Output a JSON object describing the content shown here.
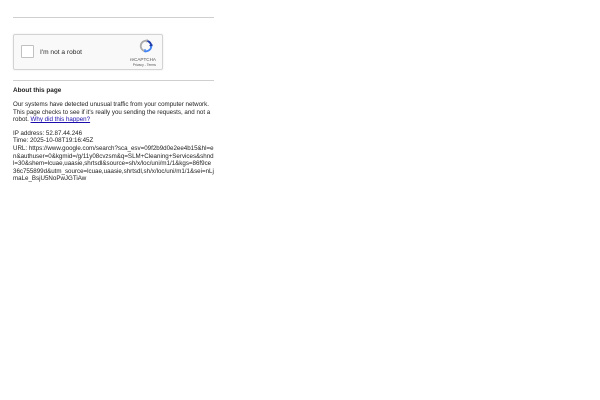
{
  "captcha": {
    "label": "I'm not a robot",
    "brand": "reCAPTCHA",
    "privacy": "Privacy",
    "separator": " - ",
    "terms": "Terms"
  },
  "about": {
    "title": "About this page",
    "body": "Our systems have detected unusual traffic from your computer network. This page checks to see if it's really you sending the requests, and not a robot. ",
    "link": "Why did this happen?"
  },
  "info": {
    "ip_label": "IP address: ",
    "ip": "52.87.44.246",
    "time_label": "Time: ",
    "time": "2025-10-08T19:16:45Z",
    "url_label": "URL: ",
    "url": "https://www.google.com/search?sca_esv=09f2b9d0e2ee4b15&hl=en&authuser=0&kgmid=/g/11y08cvzsm&q=SLM+Cleaning+Services&shndl=30&shem=lcuae,uaasie,shrtsdl&source=sh/x/loc/uni/m1/1&kgs=86f9ce36c755899d&utm_source=lcuae,uaasie,shrtsdl,sh/x/loc/uni/m1/1&sei=nLjmaLe_BsjU5NoPwJGTiAw"
  }
}
